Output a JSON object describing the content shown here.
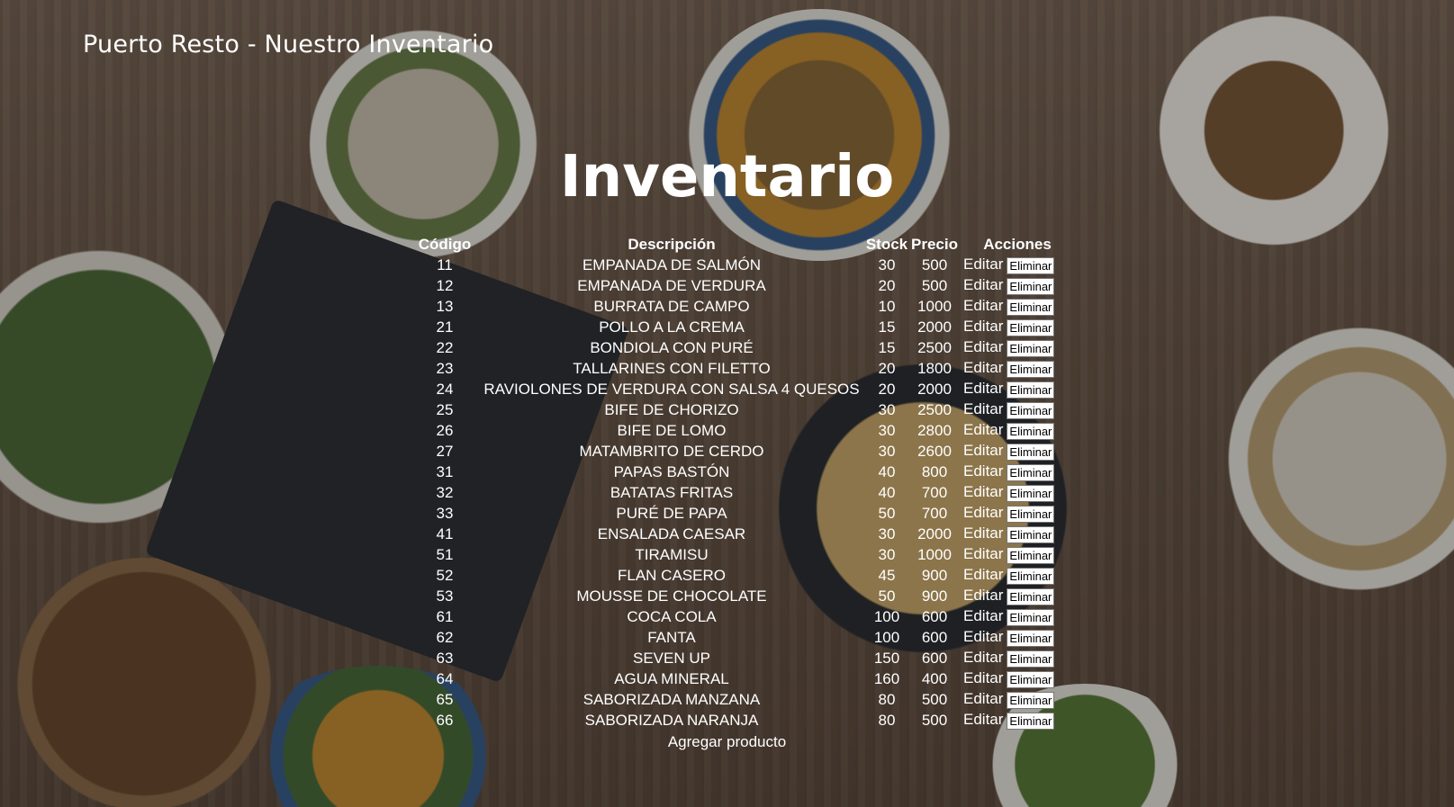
{
  "header": {
    "brand": "Puerto Resto - Nuestro Inventario"
  },
  "main": {
    "title": "Inventario",
    "columns": {
      "code": "Código",
      "desc": "Descripción",
      "stock": "Stock",
      "price": "Precio",
      "actions": "Acciones"
    },
    "edit_label": "Editar",
    "delete_label": "Eliminar",
    "rows": [
      {
        "code": "11",
        "desc": "EMPANADA DE SALMÓN",
        "stock": "30",
        "price": "500"
      },
      {
        "code": "12",
        "desc": "EMPANADA DE VERDURA",
        "stock": "20",
        "price": "500"
      },
      {
        "code": "13",
        "desc": "BURRATA DE CAMPO",
        "stock": "10",
        "price": "1000"
      },
      {
        "code": "21",
        "desc": "POLLO A LA CREMA",
        "stock": "15",
        "price": "2000"
      },
      {
        "code": "22",
        "desc": "BONDIOLA CON PURÉ",
        "stock": "15",
        "price": "2500"
      },
      {
        "code": "23",
        "desc": "TALLARINES CON FILETTO",
        "stock": "20",
        "price": "1800"
      },
      {
        "code": "24",
        "desc": "RAVIOLONES DE VERDURA CON SALSA 4 QUESOS",
        "stock": "20",
        "price": "2000"
      },
      {
        "code": "25",
        "desc": "BIFE DE CHORIZO",
        "stock": "30",
        "price": "2500"
      },
      {
        "code": "26",
        "desc": "BIFE DE LOMO",
        "stock": "30",
        "price": "2800"
      },
      {
        "code": "27",
        "desc": "MATAMBRITO DE CERDO",
        "stock": "30",
        "price": "2600"
      },
      {
        "code": "31",
        "desc": "PAPAS BASTÓN",
        "stock": "40",
        "price": "800"
      },
      {
        "code": "32",
        "desc": "BATATAS FRITAS",
        "stock": "40",
        "price": "700"
      },
      {
        "code": "33",
        "desc": "PURÉ DE PAPA",
        "stock": "50",
        "price": "700"
      },
      {
        "code": "41",
        "desc": "ENSALADA CAESAR",
        "stock": "30",
        "price": "2000"
      },
      {
        "code": "51",
        "desc": "TIRAMISU",
        "stock": "30",
        "price": "1000"
      },
      {
        "code": "52",
        "desc": "FLAN CASERO",
        "stock": "45",
        "price": "900"
      },
      {
        "code": "53",
        "desc": "MOUSSE DE CHOCOLATE",
        "stock": "50",
        "price": "900"
      },
      {
        "code": "61",
        "desc": "COCA COLA",
        "stock": "100",
        "price": "600"
      },
      {
        "code": "62",
        "desc": "FANTA",
        "stock": "100",
        "price": "600"
      },
      {
        "code": "63",
        "desc": "SEVEN UP",
        "stock": "150",
        "price": "600"
      },
      {
        "code": "64",
        "desc": "AGUA MINERAL",
        "stock": "160",
        "price": "400"
      },
      {
        "code": "65",
        "desc": "SABORIZADA MANZANA",
        "stock": "80",
        "price": "500"
      },
      {
        "code": "66",
        "desc": "SABORIZADA NARANJA",
        "stock": "80",
        "price": "500"
      }
    ],
    "add_label": "Agregar producto"
  }
}
